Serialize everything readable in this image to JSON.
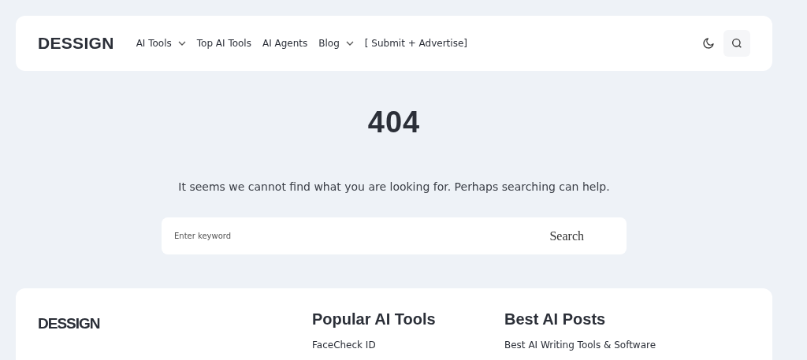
{
  "header": {
    "logo": "DESSIGN",
    "nav": [
      {
        "label": "AI Tools",
        "dropdown": true
      },
      {
        "label": "Top AI Tools",
        "dropdown": false
      },
      {
        "label": "AI Agents",
        "dropdown": false
      },
      {
        "label": "Blog",
        "dropdown": true
      },
      {
        "label": "[ Submit + Advertise]",
        "dropdown": false
      }
    ]
  },
  "error": {
    "code": "404",
    "message": "It seems we cannot find what you are looking for. Perhaps searching can help.",
    "search": {
      "placeholder": "Enter keyword",
      "button": "Search"
    }
  },
  "footer": {
    "logo": "DESSIGN",
    "columns": [
      {
        "title": "Popular AI Tools",
        "links": [
          "FaceCheck ID"
        ]
      },
      {
        "title": "Best AI Posts",
        "links": [
          "Best AI Writing Tools & Software"
        ]
      }
    ]
  }
}
